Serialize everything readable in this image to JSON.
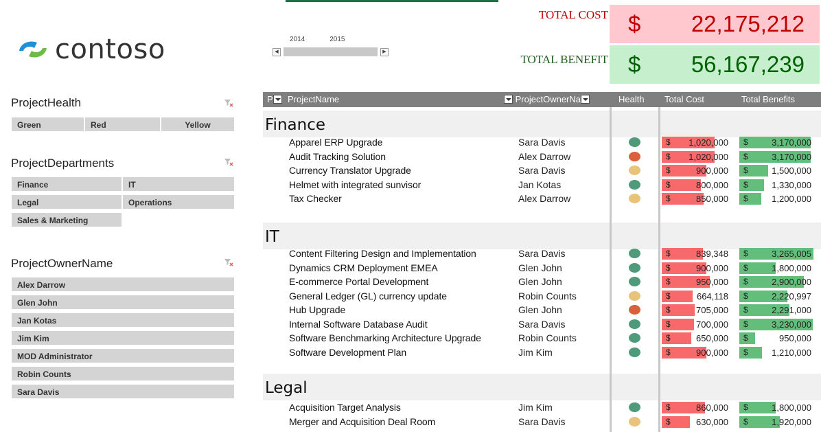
{
  "brand": {
    "name": "contoso"
  },
  "timeline": {
    "years": [
      "2014",
      "2015"
    ],
    "left_arrow": "◀",
    "right_arrow": "▶"
  },
  "kpis": {
    "cost": {
      "label": "TOTAL COST",
      "currency": "$",
      "value": "22,175,212"
    },
    "benefit": {
      "label": "TOTAL BENEFIT",
      "currency": "$",
      "value": "56,167,239"
    }
  },
  "slicers": {
    "health": {
      "title": "ProjectHealth",
      "items": [
        "Green",
        "Red",
        "Yellow"
      ]
    },
    "departments": {
      "title": "ProjectDepartments",
      "items": [
        "Finance",
        "IT",
        "Legal",
        "Operations",
        "Sales & Marketing"
      ]
    },
    "owners": {
      "title": "ProjectOwnerName",
      "items": [
        "Alex Darrow",
        "Glen John",
        "Jan Kotas",
        "Jim Kim",
        "MOD Administrator",
        "Robin Counts",
        "Sara Davis"
      ]
    }
  },
  "table": {
    "headers": {
      "p": "P",
      "name": "ProjectName",
      "owner": "ProjectOwnerNa",
      "health": "Health",
      "cost": "Total Cost",
      "benefits": "Total Benefits"
    },
    "colors": {
      "Green": "#4e9a7a",
      "Red": "#d9603b",
      "Yellow": "#e8c37c"
    },
    "groups": [
      {
        "name": "Finance",
        "rows": [
          {
            "name": "Apparel ERP Upgrade",
            "owner": "Sara Davis",
            "health": "Green",
            "cost": "1,020,000",
            "cost_ratio": 0.73,
            "benefit": "3,170,000",
            "benefit_ratio": 0.92
          },
          {
            "name": "Audit Tracking Solution",
            "owner": "Alex Darrow",
            "health": "Red",
            "cost": "1,020,000",
            "cost_ratio": 0.73,
            "benefit": "3,170,000",
            "benefit_ratio": 0.92
          },
          {
            "name": "Currency Translator Upgrade",
            "owner": "Sara Davis",
            "health": "Yellow",
            "cost": "900,000",
            "cost_ratio": 0.62,
            "benefit": "1,500,000",
            "benefit_ratio": 0.37
          },
          {
            "name": "Helmet with integrated sunvisor",
            "owner": "Jan Kotas",
            "health": "Green",
            "cost": "800,000",
            "cost_ratio": 0.54,
            "benefit": "1,330,000",
            "benefit_ratio": 0.32
          },
          {
            "name": "Tax Checker",
            "owner": "Alex Darrow",
            "health": "Yellow",
            "cost": "850,000",
            "cost_ratio": 0.58,
            "benefit": "1,200,000",
            "benefit_ratio": 0.28
          }
        ]
      },
      {
        "name": "IT",
        "rows": [
          {
            "name": "Content Filtering Design and Implementation",
            "owner": "Sara Davis",
            "health": "Green",
            "cost": "839,348",
            "cost_ratio": 0.57,
            "benefit": "3,265,005",
            "benefit_ratio": 0.96
          },
          {
            "name": "Dynamics CRM Deployment EMEA",
            "owner": "Glen John",
            "health": "Green",
            "cost": "900,000",
            "cost_ratio": 0.62,
            "benefit": "1,800,000",
            "benefit_ratio": 0.47
          },
          {
            "name": "E-commerce Portal Development",
            "owner": "Glen John",
            "health": "Green",
            "cost": "950,000",
            "cost_ratio": 0.67,
            "benefit": "2,900,000",
            "benefit_ratio": 0.83
          },
          {
            "name": "General Ledger (GL) currency update",
            "owner": "Robin Counts",
            "health": "Yellow",
            "cost": "664,118",
            "cost_ratio": 0.43,
            "benefit": "2,220,997",
            "benefit_ratio": 0.62
          },
          {
            "name": "Hub Upgrade",
            "owner": "Glen John",
            "health": "Red",
            "cost": "705,000",
            "cost_ratio": 0.46,
            "benefit": "2,291,000",
            "benefit_ratio": 0.65
          },
          {
            "name": "Internal Software Database Audit",
            "owner": "Sara Davis",
            "health": "Green",
            "cost": "700,000",
            "cost_ratio": 0.45,
            "benefit": "3,230,000",
            "benefit_ratio": 0.95
          },
          {
            "name": "Software Benchmarking Architecture Upgrade",
            "owner": "Robin Counts",
            "health": "Green",
            "cost": "650,000",
            "cost_ratio": 0.41,
            "benefit": "950,000",
            "benefit_ratio": 0.2
          },
          {
            "name": "Software Development Plan",
            "owner": "Jim Kim",
            "health": "Green",
            "cost": "900,000",
            "cost_ratio": 0.62,
            "benefit": "1,210,000",
            "benefit_ratio": 0.29
          }
        ]
      },
      {
        "name": "Legal",
        "rows": [
          {
            "name": "Acquisition Target Analysis",
            "owner": "Jim Kim",
            "health": "Green",
            "cost": "860,000",
            "cost_ratio": 0.6,
            "benefit": "1,800,000",
            "benefit_ratio": 0.47
          },
          {
            "name": "Merger and Acquisition Deal Room",
            "owner": "Sara Davis",
            "health": "Yellow",
            "cost": "630,000",
            "cost_ratio": 0.39,
            "benefit": "1,920,000",
            "benefit_ratio": 0.52
          }
        ]
      }
    ]
  }
}
